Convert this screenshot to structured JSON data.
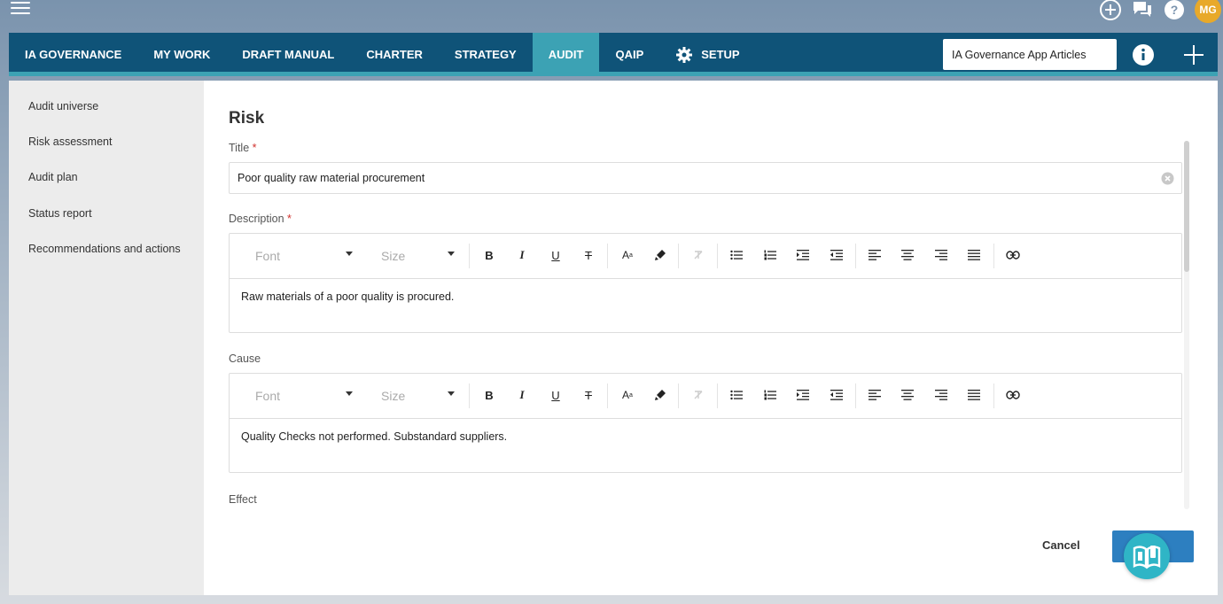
{
  "topbar": {
    "avatar_initials": "MG",
    "icons": [
      "menu-icon",
      "add-circle-icon",
      "chat-icon",
      "help-icon"
    ]
  },
  "nav": {
    "items": [
      {
        "label": "IA GOVERNANCE"
      },
      {
        "label": "MY WORK"
      },
      {
        "label": "DRAFT MANUAL"
      },
      {
        "label": "CHARTER"
      },
      {
        "label": "STRATEGY"
      },
      {
        "label": "AUDIT",
        "active": true
      },
      {
        "label": "QAIP"
      },
      {
        "label": "SETUP"
      }
    ],
    "search_value": "IA Governance App Articles",
    "colors": {
      "nav_bg": "#0f5378",
      "active_bg": "#3ca2b4"
    }
  },
  "sidebar": {
    "items": [
      {
        "label": "Audit universe"
      },
      {
        "label": "Risk assessment"
      },
      {
        "label": "Audit plan"
      },
      {
        "label": "Status report"
      },
      {
        "label": "Recommendations and actions"
      }
    ]
  },
  "form": {
    "heading": "Risk",
    "title_label": "Title",
    "required_mark": "*",
    "title_value": "Poor quality raw material procurement",
    "description_label": "Description",
    "description_value": "Raw materials of a poor quality is procured.",
    "cause_label": "Cause",
    "cause_value": "Quality Checks not performed. Substandard suppliers.",
    "effect_label": "Effect",
    "toolbar": {
      "font_placeholder": "Font",
      "size_placeholder": "Size",
      "bold": "B",
      "italic": "I",
      "underline": "U",
      "strike": "T",
      "font_color": "A"
    }
  },
  "actions": {
    "cancel_label": "Cancel"
  }
}
